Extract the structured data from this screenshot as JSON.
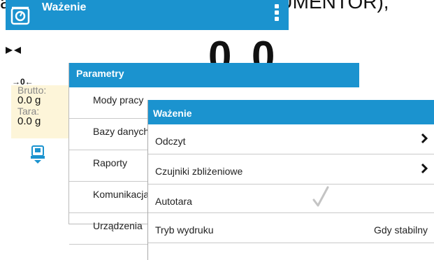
{
  "doc_text": "accesionado (por ejemplo, DOCUMENTOR),",
  "app": {
    "title": "Ważenie"
  },
  "display": {
    "value": "0.0",
    "zero_indicator": "→0←"
  },
  "info": {
    "brutto_label": "Brutto:",
    "brutto_value": "0.0 g",
    "tara_label": "Tara:",
    "tara_value": "0.0 g"
  },
  "parametry": {
    "title": "Parametry",
    "items": [
      "Mody pracy",
      "Bazy danych",
      "Raporty",
      "Komunikacja",
      "Urządzenia"
    ]
  },
  "wazenie": {
    "title": "Ważenie",
    "items": [
      {
        "label": "Odczyt",
        "type": "submenu"
      },
      {
        "label": "Czujniki zbliżeniowe",
        "type": "submenu"
      },
      {
        "label": "Autotara",
        "type": "check",
        "checked": true
      },
      {
        "label": "Tryb wydruku",
        "type": "value",
        "value": "Gdy stabilny"
      }
    ]
  },
  "colors": {
    "accent": "#1b93cf",
    "info_bg": "#fdf5d9"
  }
}
